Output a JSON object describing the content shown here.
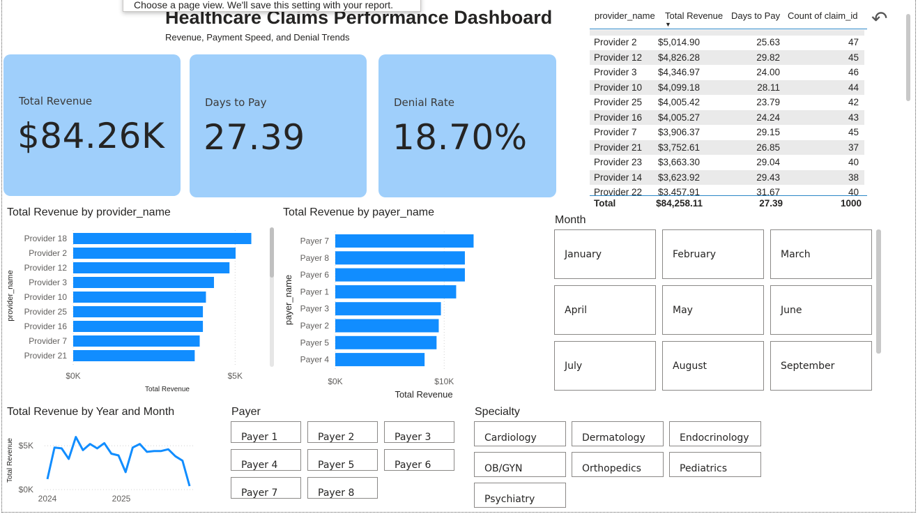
{
  "tooltip": "Choose a page view. We'll save this setting with your report.",
  "header": {
    "title": "Healthcare Claims Performance Dashboard",
    "subtitle": "Revenue, Payment Speed, and Denial Trends"
  },
  "kpis": [
    {
      "label": "Total Revenue",
      "value": "$84.26K"
    },
    {
      "label": "Days to Pay",
      "value": "27.39"
    },
    {
      "label": "Denial Rate",
      "value": "18.70%"
    }
  ],
  "table": {
    "columns": [
      "provider_name",
      "Total Revenue",
      "Days to Pay",
      "Count of claim_id"
    ],
    "rows": [
      [
        "Provider 2",
        "$5,014.90",
        "25.63",
        "47"
      ],
      [
        "Provider 12",
        "$4,826.28",
        "29.82",
        "45"
      ],
      [
        "Provider 3",
        "$4,346.97",
        "24.00",
        "46"
      ],
      [
        "Provider 10",
        "$4,099.18",
        "28.11",
        "44"
      ],
      [
        "Provider 25",
        "$4,005.42",
        "23.79",
        "42"
      ],
      [
        "Provider 16",
        "$4,005.27",
        "24.24",
        "43"
      ],
      [
        "Provider 7",
        "$3,906.37",
        "29.15",
        "45"
      ],
      [
        "Provider 21",
        "$3,752.61",
        "26.85",
        "37"
      ],
      [
        "Provider 23",
        "$3,663.30",
        "29.04",
        "40"
      ],
      [
        "Provider 14",
        "$3,623.92",
        "29.43",
        "38"
      ],
      [
        "Provider 22",
        "$3,457.91",
        "31.67",
        "40"
      ]
    ],
    "total": [
      "Total",
      "$84,258.11",
      "27.39",
      "1000"
    ]
  },
  "month_slicer": {
    "title": "Month",
    "items": [
      "January",
      "February",
      "March",
      "April",
      "May",
      "June",
      "July",
      "August",
      "September"
    ]
  },
  "payer_slicer": {
    "title": "Payer",
    "items": [
      "Payer 1",
      "Payer 2",
      "Payer 3",
      "Payer 4",
      "Payer 5",
      "Payer 6",
      "Payer 7",
      "Payer 8"
    ]
  },
  "specialty_slicer": {
    "title": "Specialty",
    "items": [
      "Cardiology",
      "Dermatology",
      "Endocrinology",
      "OB/GYN",
      "Orthopedics",
      "Pediatrics",
      "Psychiatry"
    ]
  },
  "chart_data": [
    {
      "type": "bar",
      "orientation": "horizontal",
      "title": "Total Revenue by provider_name",
      "xlabel": "Total Revenue",
      "ylabel": "provider_name",
      "categories": [
        "Provider 18",
        "Provider 2",
        "Provider 12",
        "Provider 3",
        "Provider 10",
        "Provider 25",
        "Provider 16",
        "Provider 7",
        "Provider 21"
      ],
      "values": [
        5500,
        5014.9,
        4826.28,
        4346.97,
        4099.18,
        4005.42,
        4005.27,
        3906.37,
        3752.61
      ],
      "x_ticks": [
        "$0K",
        "$5K"
      ],
      "xlim": [
        0,
        6500
      ],
      "color": "#118dff"
    },
    {
      "type": "bar",
      "orientation": "horizontal",
      "title": "Total Revenue by payer_name",
      "xlabel": "Total Revenue",
      "ylabel": "payer_name",
      "categories": [
        "Payer 7",
        "Payer 8",
        "Payer 6",
        "Payer 1",
        "Payer 3",
        "Payer 2",
        "Payer 5",
        "Payer 4"
      ],
      "values": [
        12700,
        11900,
        11900,
        11100,
        9700,
        9500,
        9300,
        8200
      ],
      "x_ticks": [
        "$0K",
        "$10K"
      ],
      "xlim": [
        0,
        16000
      ],
      "color": "#118dff"
    },
    {
      "type": "line",
      "title": "Total Revenue by Year and Month",
      "ylabel": "Total Revenue",
      "x_ticks": [
        "2024",
        "2025"
      ],
      "y_ticks": [
        "$0K",
        "$5K"
      ],
      "ylim": [
        0,
        7000
      ],
      "values": [
        1200,
        4800,
        4700,
        3500,
        6000,
        4500,
        5200,
        4700,
        5300,
        4100,
        3900,
        2000,
        4800,
        5200,
        4300,
        4400,
        4400,
        4600,
        3800,
        3300,
        400
      ],
      "color": "#118dff"
    }
  ]
}
